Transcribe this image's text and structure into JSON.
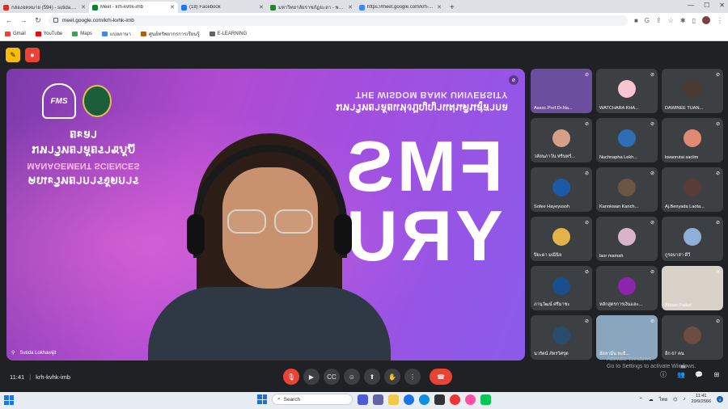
{
  "browser": {
    "tabs": [
      {
        "title": "กล่องจดหมาย (594) - sutida.s@y...",
        "color": "#d93025"
      },
      {
        "title": "Meet - krh-kvhk-imb",
        "color": "#00832d",
        "active": true
      },
      {
        "title": "(18) Facebook",
        "color": "#1877f2"
      },
      {
        "title": "มหาวิทยาลัยราชภัฏยะลา - พลังปัญญ...",
        "color": "#2e7d32"
      },
      {
        "title": "https://meet.google.com/krh-...",
        "color": "#4285f4"
      }
    ],
    "url": "meet.google.com/krh-kvhk-imb",
    "bookmarks": [
      {
        "label": "Gmail",
        "color": "#ea4335"
      },
      {
        "label": "YouTube",
        "color": "#ff0000"
      },
      {
        "label": "Maps",
        "color": "#34a853"
      },
      {
        "label": "แปลภาษา",
        "color": "#4285f4"
      },
      {
        "label": "ศูนย์ทรัพยากรการเรียนรู้",
        "color": "#b45f06"
      },
      {
        "label": "E-LEARNING",
        "color": "#5f6368"
      }
    ]
  },
  "stage": {
    "logo_text": "FMS",
    "speaker_name": "Sutida Lokhawijit",
    "slide_faculty_th": "คณะวิทยาการจัดการ",
    "slide_faculty_en": "MANAGEMENT SCIENCES",
    "slide_uni_th": "มหาวิทยาลัยราชภัฏยะลา",
    "slide_tag_th": "มหาวิทยาลัยแห่งปัญญาแผ่นดินสู่สากล",
    "slide_tag_en": "THE WISDOM BANK UNIVERSITY",
    "big_line1": "FMS",
    "big_line2": "YRU"
  },
  "participants": [
    {
      "name": "Assoc.Prof.Dr.Na...",
      "video": true,
      "color": "#6b4f9e"
    },
    {
      "name": "WATCHARA KHA...",
      "color": "#f5c6d0"
    },
    {
      "name": "DAWINEE TUAN...",
      "color": "#4a3a30"
    },
    {
      "name": "วลัยนภาวัน หรินทร์...",
      "color": "#d7a086"
    },
    {
      "name": "Nuchnapha Lekh...",
      "color": "#2f6db5"
    },
    {
      "name": "kwanrutai saclim",
      "color": "#e08a74"
    },
    {
      "name": "Sofee Hayeyusoh",
      "color": "#1c5aa8"
    },
    {
      "name": "Kanokwan Kanch...",
      "color": "#6b5646"
    },
    {
      "name": "Aj.Benyada Laota...",
      "color": "#5a3b36"
    },
    {
      "name": "ปิยะดา มณีนิล",
      "color": "#e4b24b"
    },
    {
      "name": "laor mamah",
      "color": "#d9b3c9"
    },
    {
      "name": "กูรอบาสา ดีวี",
      "color": "#8fb0d6"
    },
    {
      "name": "ภานุวัฒน์ ศรีมาชะ",
      "color": "#1a4e8c"
    },
    {
      "name": "หลักสูตรการเงินและ...",
      "color": "#8e24aa"
    },
    {
      "name": "Abbas Paiket",
      "video": true,
      "color": "#d8d2c8"
    },
    {
      "name": "นวรัตน์ ภัทรวิศรุต",
      "color": "#2a4d6e"
    },
    {
      "name": "ฮัลลามีน หะยี...",
      "video": true,
      "color": "#8aa6bf"
    },
    {
      "name": "อีก 67 คน",
      "color": "#6d4c41"
    }
  ],
  "bottom": {
    "time": "11:41",
    "code": "krh-kvhk-imb",
    "people_count": "85"
  },
  "watermark": {
    "line1": "Activate Windows",
    "line2": "Go to Settings to activate Windows."
  },
  "taskbar": {
    "search_placeholder": "Search",
    "lang": "ไทย",
    "time": "11:41",
    "date": "29/9/2566",
    "notif_count": "4"
  }
}
